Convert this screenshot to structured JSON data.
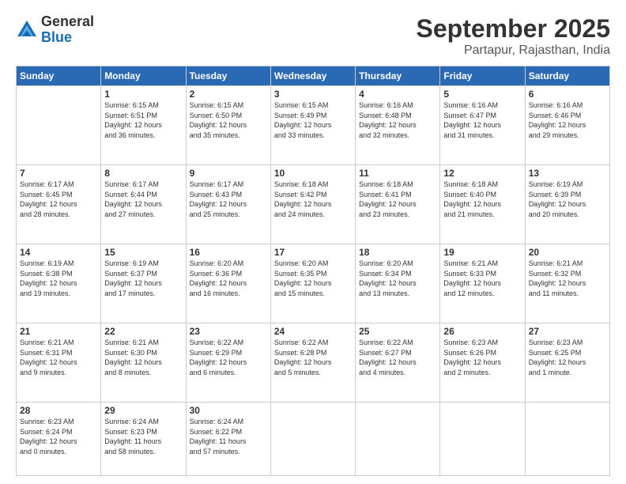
{
  "logo": {
    "general": "General",
    "blue": "Blue"
  },
  "title": "September 2025",
  "location": "Partapur, Rajasthan, India",
  "weekdays": [
    "Sunday",
    "Monday",
    "Tuesday",
    "Wednesday",
    "Thursday",
    "Friday",
    "Saturday"
  ],
  "weeks": [
    [
      {
        "day": "",
        "info": ""
      },
      {
        "day": "1",
        "info": "Sunrise: 6:15 AM\nSunset: 6:51 PM\nDaylight: 12 hours\nand 36 minutes."
      },
      {
        "day": "2",
        "info": "Sunrise: 6:15 AM\nSunset: 6:50 PM\nDaylight: 12 hours\nand 35 minutes."
      },
      {
        "day": "3",
        "info": "Sunrise: 6:15 AM\nSunset: 6:49 PM\nDaylight: 12 hours\nand 33 minutes."
      },
      {
        "day": "4",
        "info": "Sunrise: 6:16 AM\nSunset: 6:48 PM\nDaylight: 12 hours\nand 32 minutes."
      },
      {
        "day": "5",
        "info": "Sunrise: 6:16 AM\nSunset: 6:47 PM\nDaylight: 12 hours\nand 31 minutes."
      },
      {
        "day": "6",
        "info": "Sunrise: 6:16 AM\nSunset: 6:46 PM\nDaylight: 12 hours\nand 29 minutes."
      }
    ],
    [
      {
        "day": "7",
        "info": "Sunrise: 6:17 AM\nSunset: 6:45 PM\nDaylight: 12 hours\nand 28 minutes."
      },
      {
        "day": "8",
        "info": "Sunrise: 6:17 AM\nSunset: 6:44 PM\nDaylight: 12 hours\nand 27 minutes."
      },
      {
        "day": "9",
        "info": "Sunrise: 6:17 AM\nSunset: 6:43 PM\nDaylight: 12 hours\nand 25 minutes."
      },
      {
        "day": "10",
        "info": "Sunrise: 6:18 AM\nSunset: 6:42 PM\nDaylight: 12 hours\nand 24 minutes."
      },
      {
        "day": "11",
        "info": "Sunrise: 6:18 AM\nSunset: 6:41 PM\nDaylight: 12 hours\nand 23 minutes."
      },
      {
        "day": "12",
        "info": "Sunrise: 6:18 AM\nSunset: 6:40 PM\nDaylight: 12 hours\nand 21 minutes."
      },
      {
        "day": "13",
        "info": "Sunrise: 6:19 AM\nSunset: 6:39 PM\nDaylight: 12 hours\nand 20 minutes."
      }
    ],
    [
      {
        "day": "14",
        "info": "Sunrise: 6:19 AM\nSunset: 6:38 PM\nDaylight: 12 hours\nand 19 minutes."
      },
      {
        "day": "15",
        "info": "Sunrise: 6:19 AM\nSunset: 6:37 PM\nDaylight: 12 hours\nand 17 minutes."
      },
      {
        "day": "16",
        "info": "Sunrise: 6:20 AM\nSunset: 6:36 PM\nDaylight: 12 hours\nand 16 minutes."
      },
      {
        "day": "17",
        "info": "Sunrise: 6:20 AM\nSunset: 6:35 PM\nDaylight: 12 hours\nand 15 minutes."
      },
      {
        "day": "18",
        "info": "Sunrise: 6:20 AM\nSunset: 6:34 PM\nDaylight: 12 hours\nand 13 minutes."
      },
      {
        "day": "19",
        "info": "Sunrise: 6:21 AM\nSunset: 6:33 PM\nDaylight: 12 hours\nand 12 minutes."
      },
      {
        "day": "20",
        "info": "Sunrise: 6:21 AM\nSunset: 6:32 PM\nDaylight: 12 hours\nand 11 minutes."
      }
    ],
    [
      {
        "day": "21",
        "info": "Sunrise: 6:21 AM\nSunset: 6:31 PM\nDaylight: 12 hours\nand 9 minutes."
      },
      {
        "day": "22",
        "info": "Sunrise: 6:21 AM\nSunset: 6:30 PM\nDaylight: 12 hours\nand 8 minutes."
      },
      {
        "day": "23",
        "info": "Sunrise: 6:22 AM\nSunset: 6:29 PM\nDaylight: 12 hours\nand 6 minutes."
      },
      {
        "day": "24",
        "info": "Sunrise: 6:22 AM\nSunset: 6:28 PM\nDaylight: 12 hours\nand 5 minutes."
      },
      {
        "day": "25",
        "info": "Sunrise: 6:22 AM\nSunset: 6:27 PM\nDaylight: 12 hours\nand 4 minutes."
      },
      {
        "day": "26",
        "info": "Sunrise: 6:23 AM\nSunset: 6:26 PM\nDaylight: 12 hours\nand 2 minutes."
      },
      {
        "day": "27",
        "info": "Sunrise: 6:23 AM\nSunset: 6:25 PM\nDaylight: 12 hours\nand 1 minute."
      }
    ],
    [
      {
        "day": "28",
        "info": "Sunrise: 6:23 AM\nSunset: 6:24 PM\nDaylight: 12 hours\nand 0 minutes."
      },
      {
        "day": "29",
        "info": "Sunrise: 6:24 AM\nSunset: 6:23 PM\nDaylight: 11 hours\nand 58 minutes."
      },
      {
        "day": "30",
        "info": "Sunrise: 6:24 AM\nSunset: 6:22 PM\nDaylight: 11 hours\nand 57 minutes."
      },
      {
        "day": "",
        "info": ""
      },
      {
        "day": "",
        "info": ""
      },
      {
        "day": "",
        "info": ""
      },
      {
        "day": "",
        "info": ""
      }
    ]
  ]
}
